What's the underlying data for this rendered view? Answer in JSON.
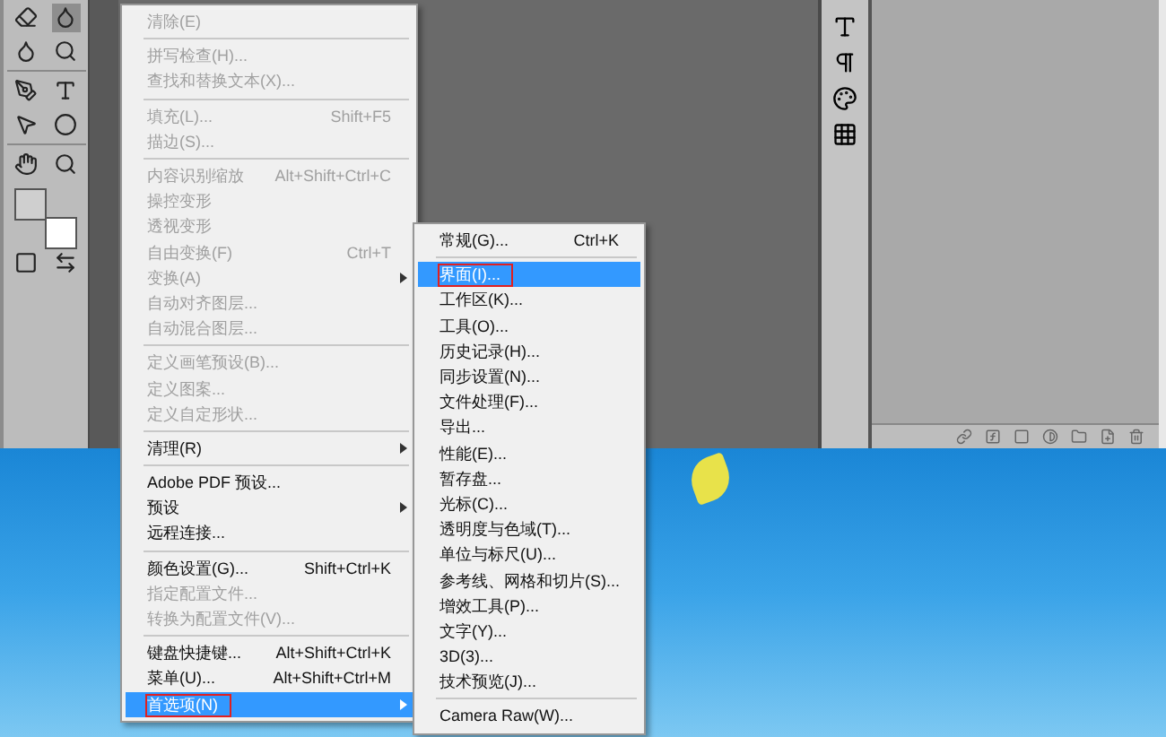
{
  "edit_menu": {
    "items": [
      {
        "kind": "item",
        "label": "清除(E)",
        "disabled": true,
        "submenu": false,
        "selected": false,
        "marked": false
      },
      {
        "kind": "separator"
      },
      {
        "kind": "item",
        "label": "拼写检查(H)...",
        "disabled": true,
        "submenu": false,
        "selected": false,
        "marked": false
      },
      {
        "kind": "item",
        "label": "查找和替换文本(X)...",
        "disabled": true,
        "submenu": false,
        "selected": false,
        "marked": false
      },
      {
        "kind": "separator"
      },
      {
        "kind": "item",
        "label": "填充(L)...",
        "shortcut": "Shift+F5",
        "disabled": true,
        "submenu": false,
        "selected": false,
        "marked": false
      },
      {
        "kind": "item",
        "label": "描边(S)...",
        "disabled": true,
        "submenu": false,
        "selected": false,
        "marked": false
      },
      {
        "kind": "separator"
      },
      {
        "kind": "item",
        "label": "内容识别缩放",
        "shortcut": "Alt+Shift+Ctrl+C",
        "disabled": true,
        "submenu": false,
        "selected": false,
        "marked": false
      },
      {
        "kind": "item",
        "label": "操控变形",
        "disabled": true,
        "submenu": false,
        "selected": false,
        "marked": false
      },
      {
        "kind": "item",
        "label": "透视变形",
        "disabled": true,
        "submenu": false,
        "selected": false,
        "marked": false
      },
      {
        "kind": "item",
        "label": "自由变换(F)",
        "shortcut": "Ctrl+T",
        "disabled": true,
        "submenu": false,
        "selected": false,
        "marked": false
      },
      {
        "kind": "item",
        "label": "变换(A)",
        "disabled": true,
        "submenu": true,
        "selected": false,
        "marked": false
      },
      {
        "kind": "item",
        "label": "自动对齐图层...",
        "disabled": true,
        "submenu": false,
        "selected": false,
        "marked": false
      },
      {
        "kind": "item",
        "label": "自动混合图层...",
        "disabled": true,
        "submenu": false,
        "selected": false,
        "marked": false
      },
      {
        "kind": "separator"
      },
      {
        "kind": "item",
        "label": "定义画笔预设(B)...",
        "disabled": true,
        "submenu": false,
        "selected": false,
        "marked": false
      },
      {
        "kind": "item",
        "label": "定义图案...",
        "disabled": true,
        "submenu": false,
        "selected": false,
        "marked": false
      },
      {
        "kind": "item",
        "label": "定义自定形状...",
        "disabled": true,
        "submenu": false,
        "selected": false,
        "marked": false
      },
      {
        "kind": "separator"
      },
      {
        "kind": "item",
        "label": "清理(R)",
        "disabled": false,
        "submenu": true,
        "selected": false,
        "marked": false
      },
      {
        "kind": "separator"
      },
      {
        "kind": "item",
        "label": "Adobe PDF 预设...",
        "disabled": false,
        "submenu": false,
        "selected": false,
        "marked": false
      },
      {
        "kind": "item",
        "label": "预设",
        "disabled": false,
        "submenu": true,
        "selected": false,
        "marked": false
      },
      {
        "kind": "item",
        "label": "远程连接...",
        "disabled": false,
        "submenu": false,
        "selected": false,
        "marked": false
      },
      {
        "kind": "separator"
      },
      {
        "kind": "item",
        "label": "颜色设置(G)...",
        "shortcut": "Shift+Ctrl+K",
        "disabled": false,
        "submenu": false,
        "selected": false,
        "marked": false
      },
      {
        "kind": "item",
        "label": "指定配置文件...",
        "disabled": true,
        "submenu": false,
        "selected": false,
        "marked": false
      },
      {
        "kind": "item",
        "label": "转换为配置文件(V)...",
        "disabled": true,
        "submenu": false,
        "selected": false,
        "marked": false
      },
      {
        "kind": "separator"
      },
      {
        "kind": "item",
        "label": "键盘快捷键...",
        "shortcut": "Alt+Shift+Ctrl+K",
        "disabled": false,
        "submenu": false,
        "selected": false,
        "marked": false
      },
      {
        "kind": "item",
        "label": "菜单(U)...",
        "shortcut": "Alt+Shift+Ctrl+M",
        "disabled": false,
        "submenu": false,
        "selected": false,
        "marked": false
      },
      {
        "kind": "item",
        "label": "首选项(N)",
        "disabled": false,
        "submenu": true,
        "selected": true,
        "marked": true
      }
    ]
  },
  "preferences_submenu": {
    "items": [
      {
        "kind": "item",
        "label": "常规(G)...",
        "shortcut": "Ctrl+K",
        "selected": false,
        "marked": false
      },
      {
        "kind": "separator"
      },
      {
        "kind": "item",
        "label": "界面(I)...",
        "selected": true,
        "marked": true
      },
      {
        "kind": "item",
        "label": "工作区(K)...",
        "selected": false,
        "marked": false
      },
      {
        "kind": "item",
        "label": "工具(O)...",
        "selected": false,
        "marked": false
      },
      {
        "kind": "item",
        "label": "历史记录(H)...",
        "selected": false,
        "marked": false
      },
      {
        "kind": "item",
        "label": "同步设置(N)...",
        "selected": false,
        "marked": false
      },
      {
        "kind": "item",
        "label": "文件处理(F)...",
        "selected": false,
        "marked": false
      },
      {
        "kind": "item",
        "label": "导出...",
        "selected": false,
        "marked": false
      },
      {
        "kind": "item",
        "label": "性能(E)...",
        "selected": false,
        "marked": false
      },
      {
        "kind": "item",
        "label": "暂存盘...",
        "selected": false,
        "marked": false
      },
      {
        "kind": "item",
        "label": "光标(C)...",
        "selected": false,
        "marked": false
      },
      {
        "kind": "item",
        "label": "透明度与色域(T)...",
        "selected": false,
        "marked": false
      },
      {
        "kind": "item",
        "label": "单位与标尺(U)...",
        "selected": false,
        "marked": false
      },
      {
        "kind": "item",
        "label": "参考线、网格和切片(S)...",
        "selected": false,
        "marked": false
      },
      {
        "kind": "item",
        "label": "增效工具(P)...",
        "selected": false,
        "marked": false
      },
      {
        "kind": "item",
        "label": "文字(Y)...",
        "selected": false,
        "marked": false
      },
      {
        "kind": "item",
        "label": "3D(3)...",
        "selected": false,
        "marked": false
      },
      {
        "kind": "item",
        "label": "技术预览(J)...",
        "selected": false,
        "marked": false
      },
      {
        "kind": "separator"
      },
      {
        "kind": "item",
        "label": "Camera Raw(W)...",
        "selected": false,
        "marked": false
      }
    ]
  }
}
